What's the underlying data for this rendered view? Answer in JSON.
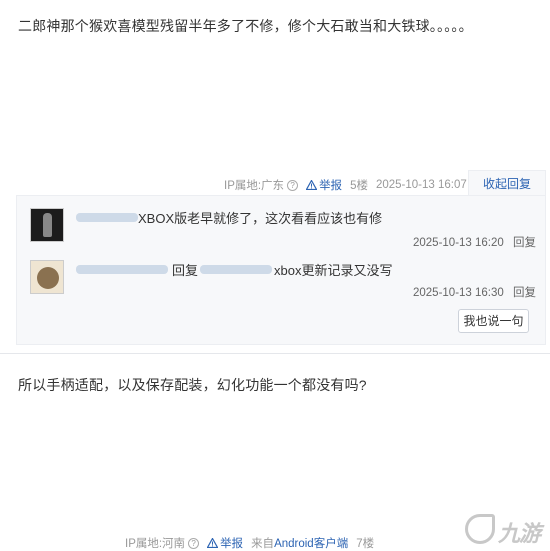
{
  "post1": {
    "content": "二郎神那个猴欢喜模型残留半年多了不修，修个大石敢当和大铁球。。。。。",
    "ip_location": "IP属地:广东",
    "report_label": "举报",
    "floor": "5楼",
    "timestamp": "2025-10-13 16:07",
    "collapse_label": "收起回复"
  },
  "replies": [
    {
      "text": "XBOX版老早就修了，这次看看应该也有修",
      "timestamp": "2025-10-13 16:20",
      "reply_label": "回复"
    },
    {
      "reply_prefix": "回复",
      "text": "xbox更新记录又没写",
      "timestamp": "2025-10-13 16:30",
      "reply_label": "回复"
    }
  ],
  "say_button_label": "我也说一句",
  "post2": {
    "content": "所以手柄适配，以及保存配装，幻化功能一个都没有吗?",
    "ip_location": "IP属地:河南",
    "report_label": "举报",
    "client_prefix": "来自",
    "client": "Android客户端",
    "floor": "7楼"
  },
  "watermark": {
    "text": "九游"
  },
  "colors": {
    "link": "#2d64b3",
    "muted": "#999999",
    "reply_bg": "#f7f8fa",
    "warn": "#2d64b3"
  },
  "icons": {
    "help": "question-circle-icon",
    "report": "warning-triangle-icon"
  }
}
